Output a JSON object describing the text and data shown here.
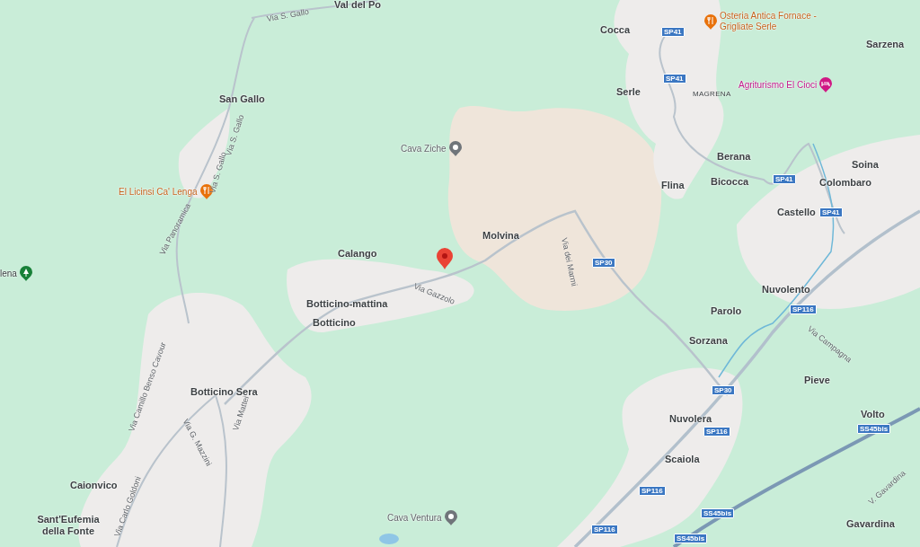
{
  "places": [
    {
      "name": "Val del Po"
    },
    {
      "name": "San Gallo"
    },
    {
      "name": "Calango"
    },
    {
      "name": "Botticino-mattina"
    },
    {
      "name": "Botticino"
    },
    {
      "name": "Botticino Sera"
    },
    {
      "name": "Caionvico"
    },
    {
      "name": "Sant'Eufemia della Fonte"
    },
    {
      "name": "Cocca"
    },
    {
      "name": "Sarzena"
    },
    {
      "name": "Serle"
    },
    {
      "name": "Molvina"
    },
    {
      "name": "Berana"
    },
    {
      "name": "Flina"
    },
    {
      "name": "Bicocca"
    },
    {
      "name": "Soina"
    },
    {
      "name": "Colombaro"
    },
    {
      "name": "Castello"
    },
    {
      "name": "Nuvolento"
    },
    {
      "name": "Parolo"
    },
    {
      "name": "Sorzana"
    },
    {
      "name": "Pieve"
    },
    {
      "name": "Nuvolera"
    },
    {
      "name": "Volto"
    },
    {
      "name": "Scaiola"
    },
    {
      "name": "Gavardina"
    }
  ],
  "localities": [
    {
      "name": "MAGRENA"
    }
  ],
  "pois": [
    {
      "name": "Cava Ziche",
      "kind": "landmark"
    },
    {
      "name": "El Licinsi Ca' Lenga",
      "kind": "restaurant"
    },
    {
      "name": "Osteria Antica Fornace - Grigliate Serle",
      "kind": "restaurant"
    },
    {
      "name": "Agriturismo El Cioci",
      "kind": "lodging"
    },
    {
      "name": "Cava Ventura",
      "kind": "landmark"
    },
    {
      "name": "lena",
      "kind": "park"
    }
  ],
  "road_shields": [
    {
      "label": "SP41"
    },
    {
      "label": "SP41"
    },
    {
      "label": "SP41"
    },
    {
      "label": "SP41"
    },
    {
      "label": "SP30"
    },
    {
      "label": "SP30"
    },
    {
      "label": "SP116"
    },
    {
      "label": "SP116"
    },
    {
      "label": "SP116"
    },
    {
      "label": "SP116"
    },
    {
      "label": "SS45bis"
    },
    {
      "label": "SS45bis"
    },
    {
      "label": "SS45bis"
    }
  ],
  "streets": [
    {
      "name": "Via S. Gallo"
    },
    {
      "name": "Via S. Gallo"
    },
    {
      "name": "Via S. Gallo"
    },
    {
      "name": "Via Panoramica"
    },
    {
      "name": "Via Gazzolo"
    },
    {
      "name": "Via dei Marmi"
    },
    {
      "name": "Via Camillo Benso Cavour"
    },
    {
      "name": "Via G. Mazzini"
    },
    {
      "name": "Via Mattei"
    },
    {
      "name": "Via Carlo Goldoni"
    },
    {
      "name": "Via Campagna"
    },
    {
      "name": "V. Gavardina"
    }
  ]
}
